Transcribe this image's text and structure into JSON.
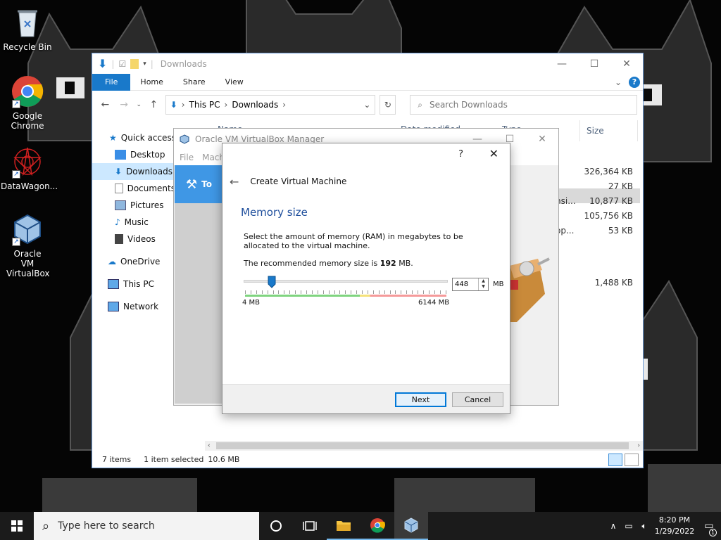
{
  "desktop": {
    "icons": [
      {
        "label": "Recycle Bin"
      },
      {
        "label": "Google Chrome"
      },
      {
        "label": "DataWagon..."
      },
      {
        "label": "Oracle VM VirtualBox"
      }
    ]
  },
  "explorer": {
    "title": "Downloads",
    "ribbon_tabs": [
      "File",
      "Home",
      "Share",
      "View"
    ],
    "address": {
      "root": "This PC",
      "current": "Downloads"
    },
    "search_placeholder": "Search Downloads",
    "nav": [
      "Quick access",
      "Desktop",
      "Downloads",
      "Documents",
      "Pictures",
      "Music",
      "Videos",
      "OneDrive",
      "This PC",
      "Network"
    ],
    "columns": {
      "name": "Name",
      "date": "Date modified",
      "type": "Type",
      "size": "Size"
    },
    "sizes": [
      "326,364 KB",
      "27 KB",
      "10,877 KB",
      "105,756 KB",
      "53 KB",
      "1,488 KB"
    ],
    "partial_names": [
      "nsi...",
      "op..."
    ],
    "status": {
      "items": "7 items",
      "selected": "1 item selected",
      "selected_size": "10.6 MB"
    }
  },
  "vbox": {
    "title": "Oracle VM VirtualBox Manager",
    "menu": [
      "File",
      "Mach"
    ],
    "tools_label": "To"
  },
  "wizard": {
    "header": "Create Virtual Machine",
    "help": "?",
    "page_title": "Memory size",
    "description": "Select the amount of memory (RAM) in megabytes to be allocated to the virtual machine.",
    "recommended_prefix": "The recommended memory size is ",
    "recommended_value": "192",
    "recommended_suffix": " MB.",
    "memory_value": "448",
    "memory_unit": "MB",
    "slider_min_label": "4 MB",
    "slider_max_label": "6144 MB",
    "slider_min": 4,
    "slider_max": 6144,
    "slider_value": 448,
    "buttons": {
      "next": "Next",
      "cancel": "Cancel"
    }
  },
  "taskbar": {
    "search_placeholder": "Type here to search",
    "time": "8:20 PM",
    "date": "1/29/2022",
    "notification_count": "1"
  },
  "colors": {
    "accent": "#1979ca",
    "title_blue": "#1e4e9c",
    "selection": "#cce8ff"
  }
}
